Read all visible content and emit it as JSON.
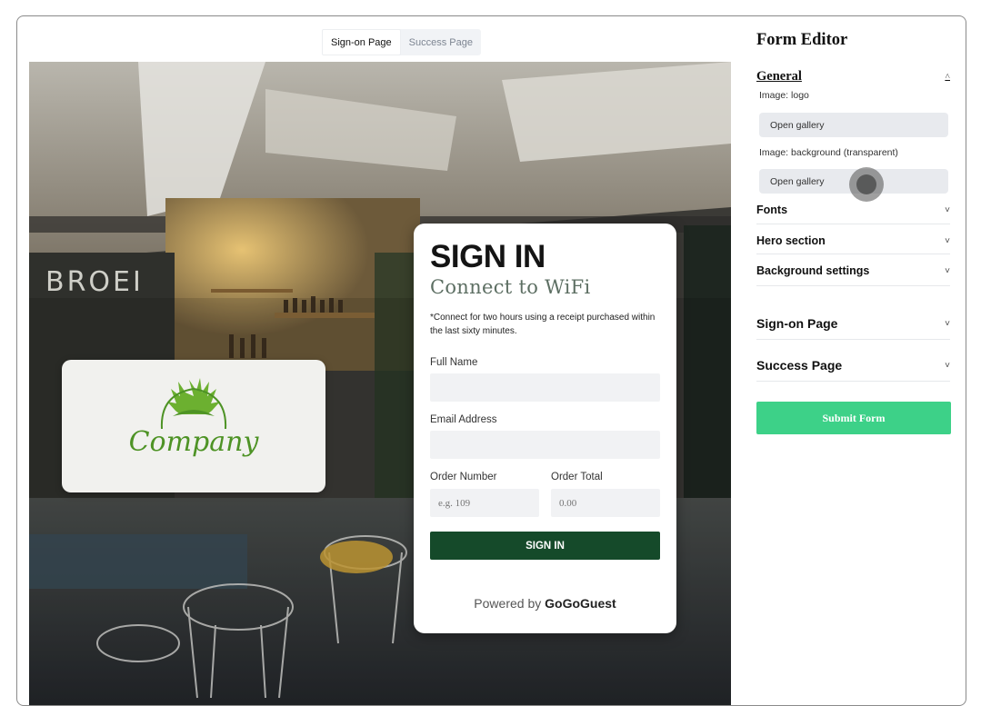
{
  "tabs": [
    {
      "label": "Sign-on Page",
      "active": true
    },
    {
      "label": "Success Page",
      "active": false
    }
  ],
  "preview": {
    "logo_text": "Company",
    "signin": {
      "title": "SIGN IN",
      "subtitle": "Connect to WiFi",
      "note": "*Connect for two hours using a receipt purchased within the last sixty minutes.",
      "full_name_label": "Full Name",
      "email_label": "Email Address",
      "order_number_label": "Order Number",
      "order_number_placeholder": "e.g. 109",
      "order_total_label": "Order Total",
      "order_total_placeholder": "0.00",
      "button_label": "SIGN IN",
      "powered_prefix": "Powered by",
      "powered_brand": "GoGoGuest"
    },
    "chalkboard_text": "BROEI"
  },
  "editor": {
    "title": "Form Editor",
    "general": {
      "label": "General",
      "logo_label": "Image: logo",
      "logo_button": "Open gallery",
      "background_label": "Image: background (transparent)",
      "background_button": "Open gallery"
    },
    "fonts_label": "Fonts",
    "hero_label": "Hero section",
    "background_settings_label": "Background settings",
    "signon_page_label": "Sign-on Page",
    "success_page_label": "Success Page",
    "submit_label": "Submit Form"
  },
  "colors": {
    "signin_button": "#154a2a",
    "submit_button": "#3dd188",
    "logo_green": "#5aa12b"
  }
}
